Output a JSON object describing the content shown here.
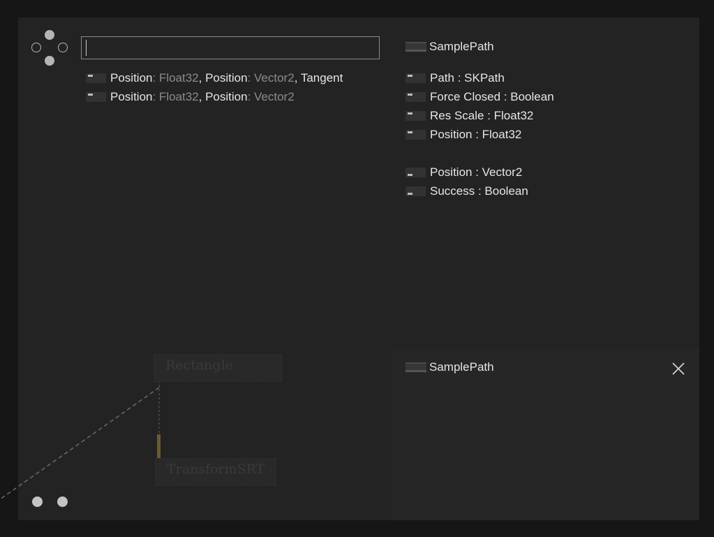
{
  "search": {
    "value": "",
    "placeholder": ""
  },
  "results": [
    {
      "parts": [
        {
          "text": "Position",
          "dim": false
        },
        {
          "text": " : Float32",
          "dim": true
        },
        {
          "text": ", Position",
          "dim": false
        },
        {
          "text": " : Vector2",
          "dim": true
        },
        {
          "text": ", Tangent",
          "dim": false
        }
      ]
    },
    {
      "parts": [
        {
          "text": "Position",
          "dim": false
        },
        {
          "text": " : Float32",
          "dim": true
        },
        {
          "text": ", Position",
          "dim": false
        },
        {
          "text": " : Vector2",
          "dim": true
        }
      ]
    }
  ],
  "node_info": {
    "title": "SamplePath",
    "inputs": [
      "Path : SKPath",
      "Force Closed : Boolean",
      "Res Scale : Float32",
      "Position : Float32"
    ],
    "outputs": [
      "Position : Vector2",
      "Success : Boolean"
    ]
  },
  "preview": {
    "title": "SamplePath"
  },
  "background_nodes": {
    "rectangle": "Rectangle",
    "transform": "TransformSRT"
  },
  "colors": {
    "background": "#161616",
    "panel": "#232323",
    "text": "#e6e6e6",
    "type_dim": "#8c8c8c",
    "connection_accent": "#6b5a2a"
  },
  "icons": {
    "dpad": "dpad-icon",
    "close": "close-icon",
    "pin": "pin-icon",
    "node": "node-icon"
  }
}
